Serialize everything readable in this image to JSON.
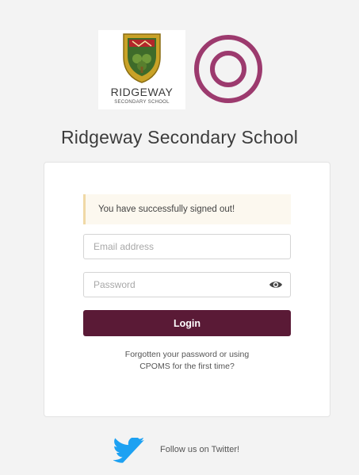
{
  "logos": {
    "crest": {
      "name": "RIDGEWAY",
      "subtitle": "SECONDARY SCHOOL",
      "icon": "school-crest-icon",
      "colors": {
        "shield": "#c9a227",
        "field": "#3e6b2a",
        "red": "#b3262b"
      }
    },
    "cpoms": {
      "icon": "cpoms-ring-icon",
      "color": "#9c3a6e"
    }
  },
  "header": {
    "title": "Ridgeway Secondary School"
  },
  "alert": {
    "message": "You have successfully signed out!"
  },
  "form": {
    "email_placeholder": "Email address",
    "password_placeholder": "Password",
    "login_label": "Login",
    "forgot_line1": "Forgotten your password or using",
    "forgot_line2": "CPOMS for the first time?"
  },
  "footer": {
    "twitter_label": "Follow us on Twitter!",
    "twitter_icon": "twitter-bird-icon",
    "twitter_color": "#1da1f2"
  },
  "colors": {
    "accent": "#5a1a36",
    "alert_bg": "#fcf8ef",
    "alert_border": "#f0d9a6"
  }
}
